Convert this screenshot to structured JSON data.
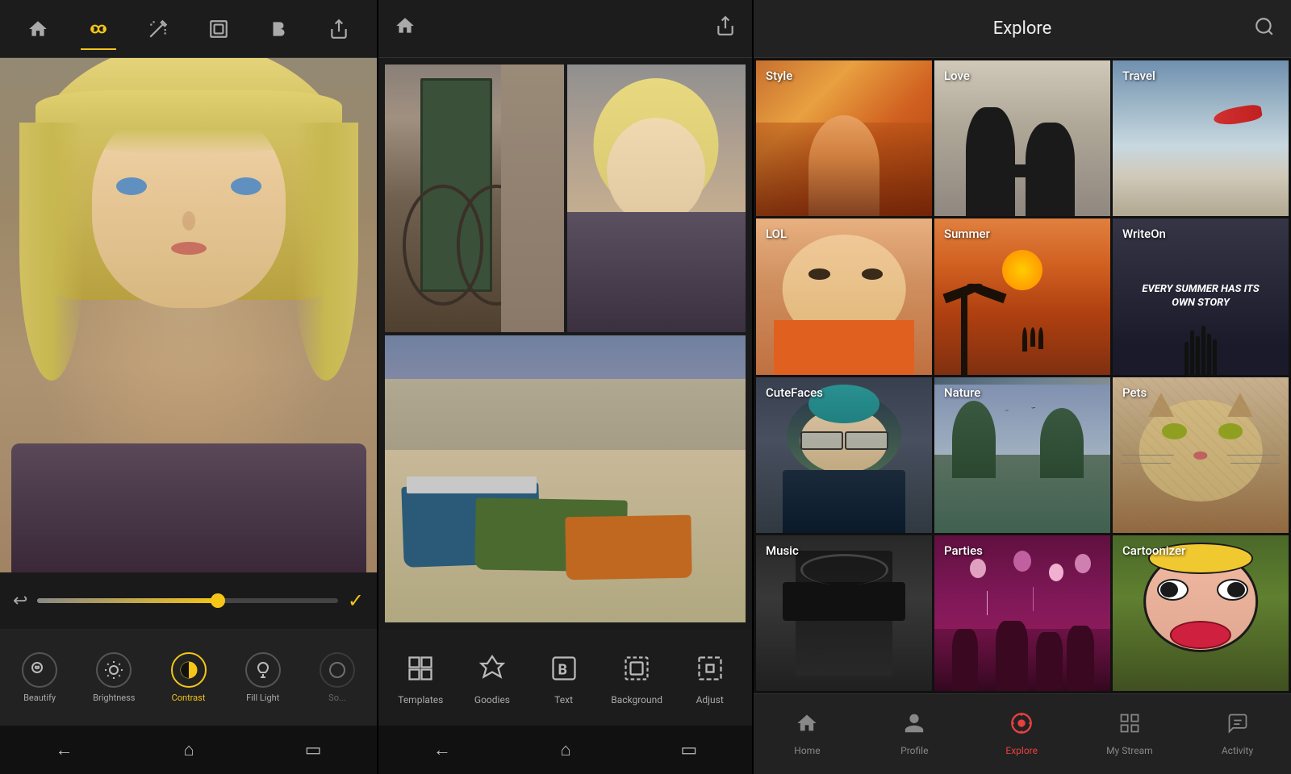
{
  "panel1": {
    "toolbar": {
      "items": [
        {
          "name": "home",
          "icon": "⌂",
          "active": false
        },
        {
          "name": "filters",
          "icon": "⊞",
          "active": true
        },
        {
          "name": "magic",
          "icon": "✦",
          "active": false
        },
        {
          "name": "crop",
          "icon": "▭",
          "active": false
        },
        {
          "name": "bold",
          "icon": "B",
          "active": false
        },
        {
          "name": "share",
          "icon": "↗",
          "active": false
        }
      ]
    },
    "slider": {
      "value": 60
    },
    "tools": [
      {
        "id": "beautify",
        "label": "Beautify",
        "icon": "☺",
        "active": false
      },
      {
        "id": "brightness",
        "label": "Brightness",
        "icon": "☀",
        "active": false
      },
      {
        "id": "contrast",
        "label": "Contrast",
        "icon": "◑",
        "active": true
      },
      {
        "id": "filllight",
        "label": "Fill Light",
        "icon": "💡",
        "active": false
      },
      {
        "id": "shadows",
        "label": "So...",
        "active": false
      }
    ],
    "nav": [
      "←",
      "⌂",
      "▭"
    ]
  },
  "panel2": {
    "collage_tools": [
      {
        "id": "templates",
        "label": "Templates",
        "icon": "⊞"
      },
      {
        "id": "goodies",
        "label": "Goodies",
        "icon": "◈"
      },
      {
        "id": "text",
        "label": "Text",
        "icon": "B"
      },
      {
        "id": "background",
        "label": "Background",
        "icon": "▢"
      },
      {
        "id": "adjust",
        "label": "Adjust",
        "icon": "⊡"
      }
    ],
    "nav": [
      "←",
      "⌂",
      "▭"
    ]
  },
  "panel3": {
    "header": {
      "title": "Explore",
      "search_icon": "🔍"
    },
    "grid": [
      {
        "id": "style",
        "label": "Style",
        "bg": "style"
      },
      {
        "id": "love",
        "label": "Love",
        "bg": "love"
      },
      {
        "id": "travel",
        "label": "Travel",
        "bg": "travel"
      },
      {
        "id": "lol",
        "label": "LOL",
        "bg": "lol"
      },
      {
        "id": "summer",
        "label": "Summer",
        "bg": "summer"
      },
      {
        "id": "writeon",
        "label": "WriteOn",
        "bg": "writeon",
        "subtext": "EVERY SUMMER HAS ITS OWN STORY"
      },
      {
        "id": "cutefaces",
        "label": "CuteFaces",
        "bg": "cutefaces"
      },
      {
        "id": "nature",
        "label": "Nature",
        "bg": "nature"
      },
      {
        "id": "pets",
        "label": "Pets",
        "bg": "pets"
      },
      {
        "id": "music",
        "label": "Music",
        "bg": "music"
      },
      {
        "id": "parties",
        "label": "Parties",
        "bg": "parties"
      },
      {
        "id": "cartoonizer",
        "label": "Cartoonizer",
        "bg": "cartoonizer"
      }
    ],
    "nav_tabs": [
      {
        "id": "home",
        "label": "Home",
        "icon": "⌂",
        "active": false
      },
      {
        "id": "profile",
        "label": "Profile",
        "icon": "👤",
        "active": false
      },
      {
        "id": "explore",
        "label": "Explore",
        "icon": "🌐",
        "active": true
      },
      {
        "id": "mystream",
        "label": "My Stream",
        "icon": "⊞",
        "active": false
      },
      {
        "id": "activity",
        "label": "Activity",
        "icon": "☰",
        "active": false
      }
    ]
  }
}
